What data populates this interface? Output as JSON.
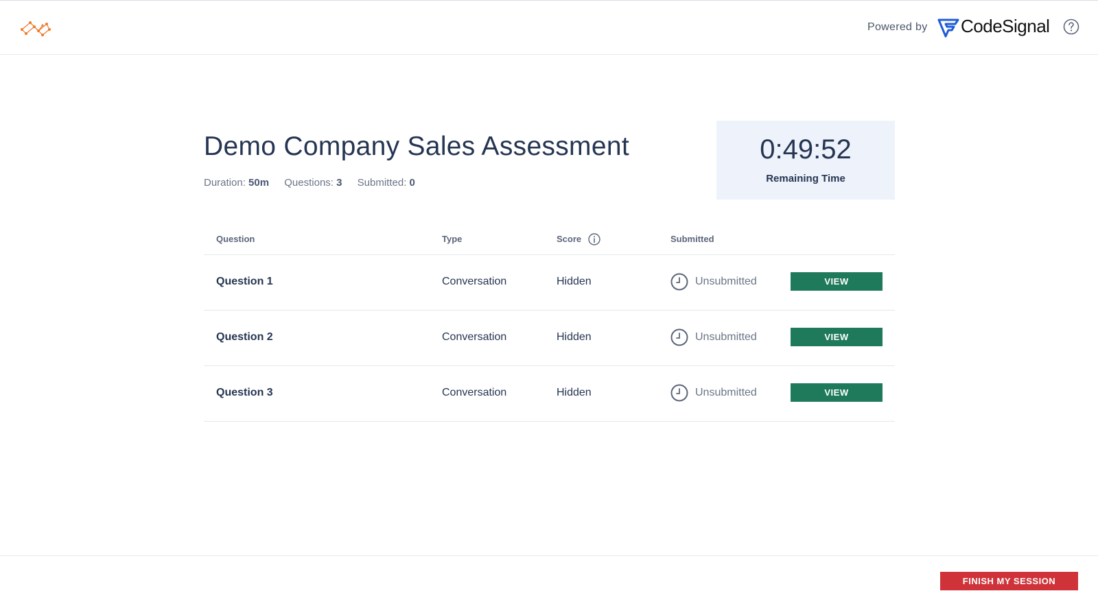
{
  "header": {
    "logo_icon": "network-graph-logo",
    "powered_by": "Powered by",
    "brand": "CodeSignal",
    "help_icon": "question-circle-icon"
  },
  "assessment": {
    "title": "Demo Company Sales Assessment",
    "duration_label": "Duration:",
    "duration_value": "50m",
    "questions_label": "Questions:",
    "questions_value": "3",
    "submitted_label": "Submitted:",
    "submitted_value": "0"
  },
  "timer": {
    "value": "0:49:52",
    "label": "Remaining Time"
  },
  "table": {
    "headers": {
      "question": "Question",
      "type": "Type",
      "score": "Score",
      "submitted": "Submitted"
    },
    "rows": [
      {
        "question": "Question 1",
        "type": "Conversation",
        "score": "Hidden",
        "status": "Unsubmitted",
        "action": "VIEW"
      },
      {
        "question": "Question 2",
        "type": "Conversation",
        "score": "Hidden",
        "status": "Unsubmitted",
        "action": "VIEW"
      },
      {
        "question": "Question 3",
        "type": "Conversation",
        "score": "Hidden",
        "status": "Unsubmitted",
        "action": "VIEW"
      }
    ]
  },
  "footer": {
    "finish_label": "FINISH MY SESSION"
  },
  "colors": {
    "primary_text": "#253552",
    "view_button": "#1f7a5c",
    "finish_button": "#cf3339",
    "timer_bg": "#eef2fa",
    "logo": "#f07a2a",
    "brand_blue": "#1e5bd8"
  }
}
